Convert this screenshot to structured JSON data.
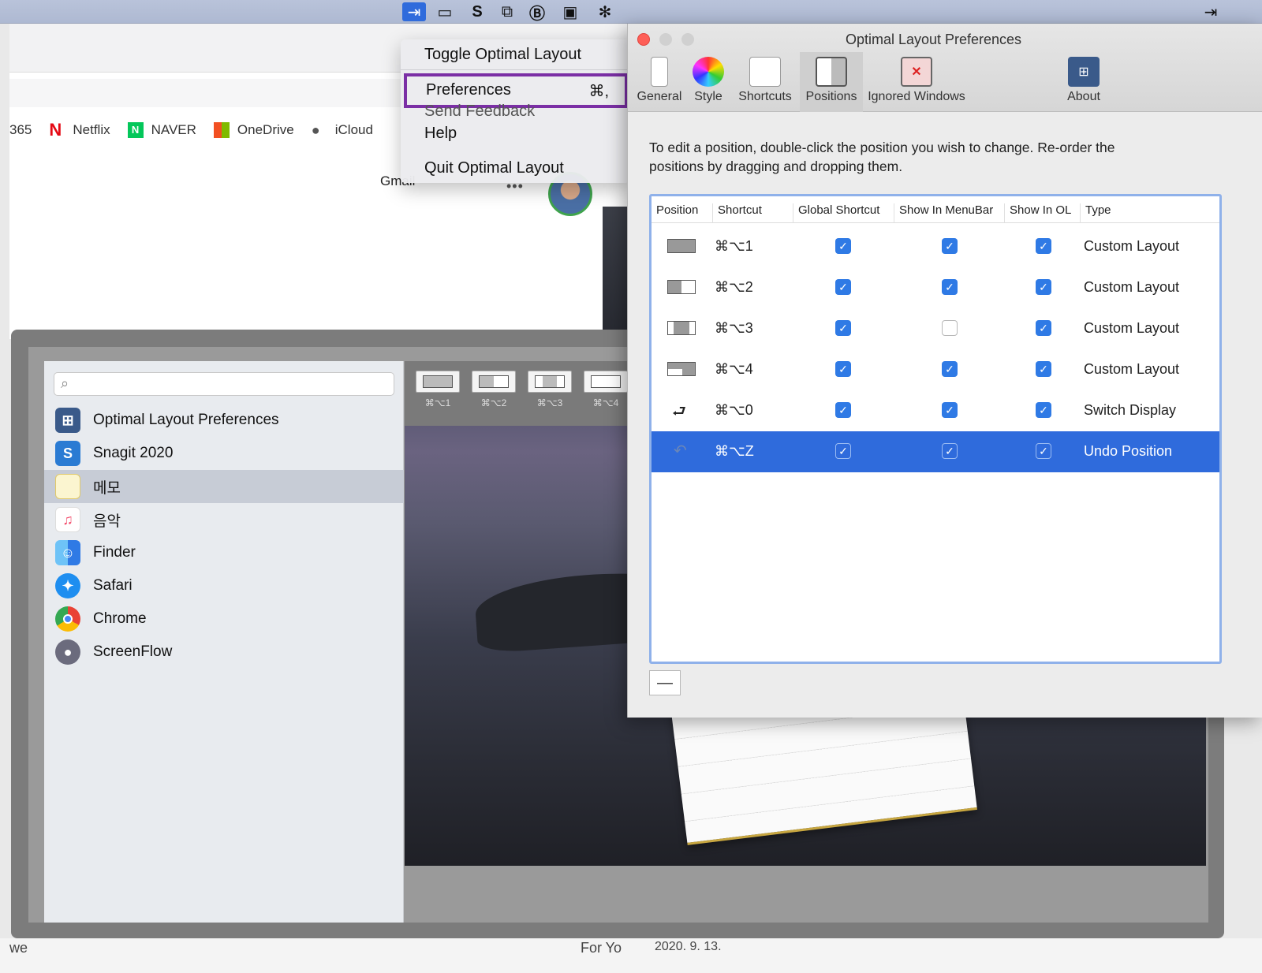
{
  "menubar": {
    "icons": [
      "optimal-layout-icon",
      "camera-icon",
      "snagit-icon",
      "toggle-icon",
      "bold-b-icon",
      "screen-icon",
      "bluetooth-icon"
    ]
  },
  "browser": {
    "bookmarks": [
      {
        "label": "365",
        "icon": "office-icon"
      },
      {
        "label": "Netflix",
        "icon": "netflix-icon",
        "color": "#e50914"
      },
      {
        "label": "NAVER",
        "icon": "naver-icon",
        "color": "#03c75a"
      },
      {
        "label": "OneDrive",
        "icon": "microsoft-icon"
      },
      {
        "label": "iCloud",
        "icon": "apple-icon"
      }
    ],
    "gmail_label": "Gmail",
    "dots": "•••"
  },
  "menu": {
    "toggle": "Toggle Optimal Layout",
    "preferences": "Preferences",
    "preferences_shortcut": "⌘,",
    "feedback": "Send Feedback",
    "help": "Help",
    "quit": "Quit Optimal Layout"
  },
  "launcher": {
    "search_placeholder": "",
    "apps": [
      {
        "label": "Optimal Layout Preferences",
        "icon": "optimal-layout-icon",
        "color": "#3a5a8a"
      },
      {
        "label": "Snagit 2020",
        "icon": "snagit-icon",
        "color": "#2a7bd3"
      },
      {
        "label": "메모",
        "icon": "notes-icon",
        "color": "#f5d76e"
      },
      {
        "label": "음악",
        "icon": "music-icon",
        "color": "#f34a6a"
      },
      {
        "label": "Finder",
        "icon": "finder-icon",
        "color": "#3b9cf2"
      },
      {
        "label": "Safari",
        "icon": "safari-icon",
        "color": "#1e8ef0"
      },
      {
        "label": "Chrome",
        "icon": "chrome-icon",
        "color": "#e94235"
      },
      {
        "label": "ScreenFlow",
        "icon": "screenflow-icon",
        "color": "#6b6b7d"
      }
    ],
    "selected_app": "메모",
    "thumbs": [
      "⌘⌥1",
      "⌘⌥2",
      "⌘⌥3",
      "⌘⌥4"
    ]
  },
  "prefs": {
    "title": "Optimal Layout Preferences",
    "tabs": [
      "General",
      "Style",
      "Shortcuts",
      "Positions",
      "Ignored Windows",
      "About"
    ],
    "active_tab": "Positions",
    "description": "To edit a position, double-click the position you wish to change. Re-order the positions by dragging and dropping them.",
    "columns": [
      "Position",
      "Shortcut",
      "Global Shortcut",
      "Show In MenuBar",
      "Show In OL",
      "Type"
    ],
    "rows": [
      {
        "shortcut": "⌘⌥1",
        "global": true,
        "menubar": true,
        "ol": true,
        "type": "Custom Layout",
        "selected": false
      },
      {
        "shortcut": "⌘⌥2",
        "global": true,
        "menubar": true,
        "ol": true,
        "type": "Custom Layout",
        "selected": false
      },
      {
        "shortcut": "⌘⌥3",
        "global": true,
        "menubar": false,
        "ol": true,
        "type": "Custom Layout",
        "selected": false
      },
      {
        "shortcut": "⌘⌥4",
        "global": true,
        "menubar": true,
        "ol": true,
        "type": "Custom Layout",
        "selected": false
      },
      {
        "shortcut": "⌘⌥0",
        "global": true,
        "menubar": true,
        "ol": true,
        "type": "Switch Display",
        "selected": false
      },
      {
        "shortcut": "⌘⌥Z",
        "global": true,
        "menubar": true,
        "ol": true,
        "type": "Undo Position",
        "selected": true
      }
    ],
    "remove_button": "—",
    "accent": "#2f6bdc"
  },
  "bottom": {
    "for_you": "For Yo",
    "date_text": "2020. 9. 13.",
    "we": "we"
  }
}
